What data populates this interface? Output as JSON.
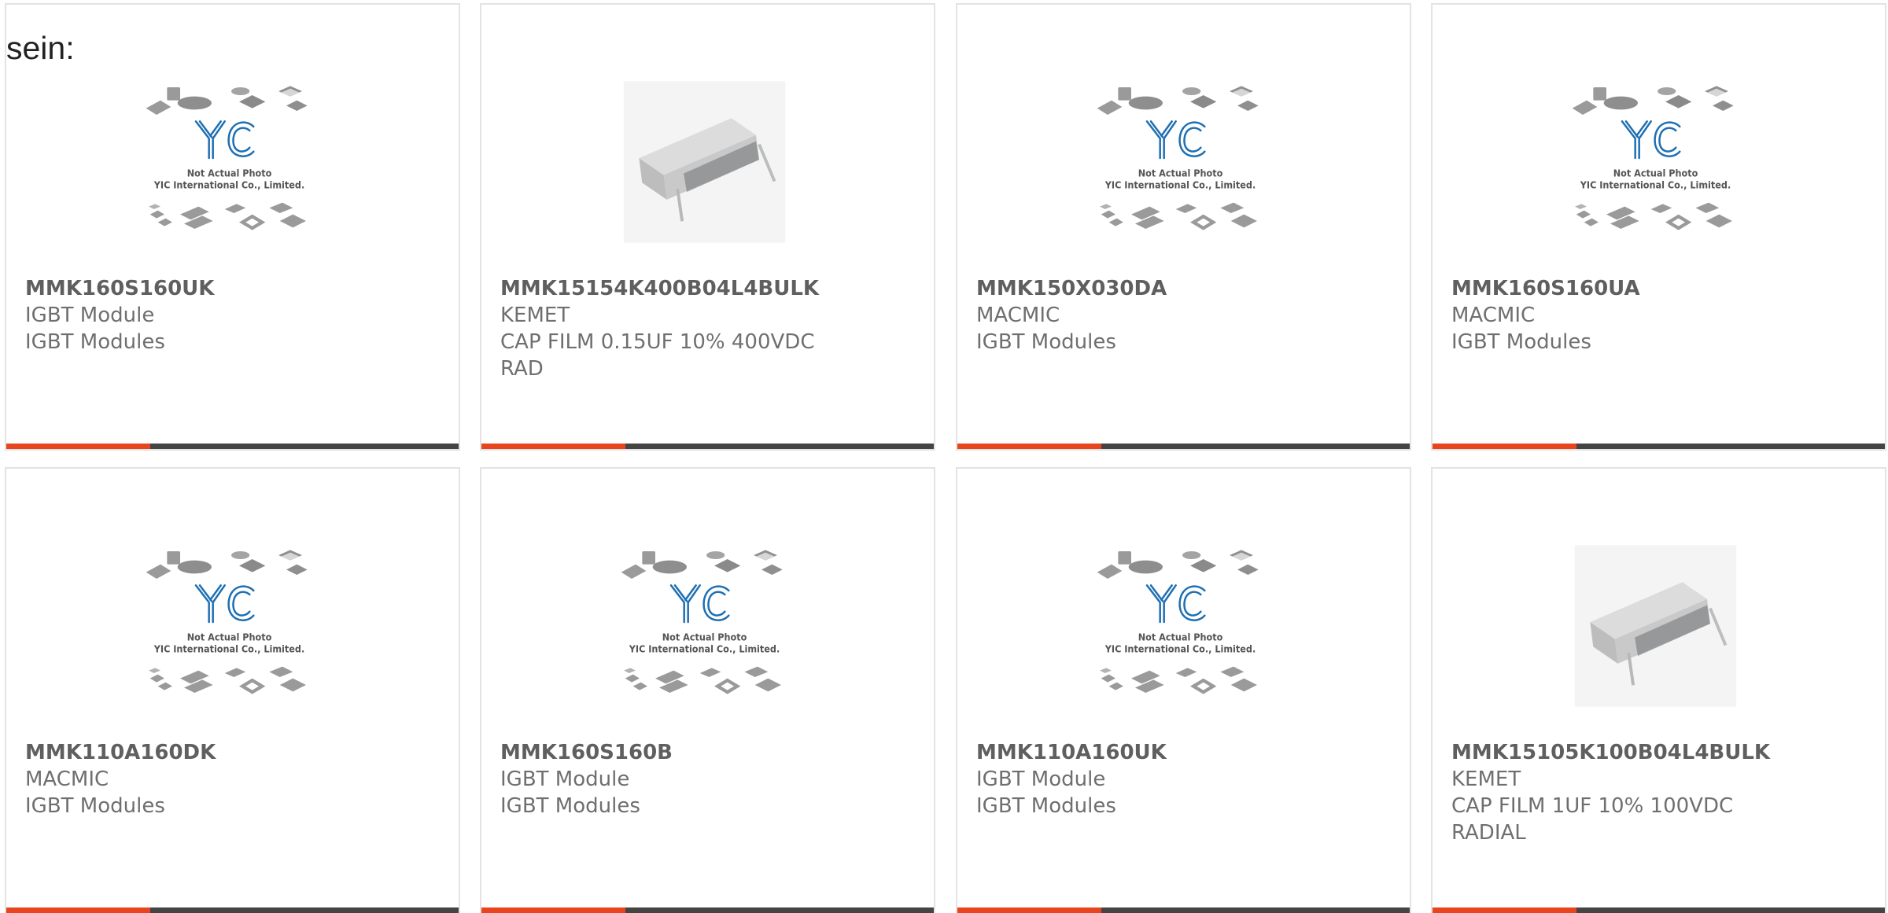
{
  "intro_text": "sein:",
  "colors": {
    "bar_accent": "#e8451f",
    "bar_dark": "#444444",
    "card_border": "#e3e3e3",
    "logo_blue": "#1e6fb3"
  },
  "placeholder_image": {
    "caption_line1": "Not Actual Photo",
    "caption_line2": "YIC International Co., Limited."
  },
  "cards": [
    {
      "part_number": "MMK160S160UK",
      "line2": "IGBT Module",
      "line3": "IGBT Modules",
      "line4": "",
      "image": "placeholder"
    },
    {
      "part_number": "MMK15154K400B04L4BULK",
      "line2": "KEMET",
      "line3": "CAP FILM 0.15UF 10% 400VDC",
      "line4": "RAD",
      "image": "capacitor-photo"
    },
    {
      "part_number": "MMK150X030DA",
      "line2": "MACMIC",
      "line3": "IGBT Modules",
      "line4": "",
      "image": "placeholder"
    },
    {
      "part_number": "MMK160S160UA",
      "line2": "MACMIC",
      "line3": "IGBT Modules",
      "line4": "",
      "image": "placeholder"
    },
    {
      "part_number": "MMK110A160DK",
      "line2": "MACMIC",
      "line3": "IGBT Modules",
      "line4": "",
      "image": "placeholder"
    },
    {
      "part_number": "MMK160S160B",
      "line2": "IGBT Module",
      "line3": "IGBT Modules",
      "line4": "",
      "image": "placeholder"
    },
    {
      "part_number": "MMK110A160UK",
      "line2": "IGBT Module",
      "line3": "IGBT Modules",
      "line4": "",
      "image": "placeholder"
    },
    {
      "part_number": "MMK15105K100B04L4BULK",
      "line2": "KEMET",
      "line3": "CAP FILM 1UF 10% 100VDC",
      "line4": "RADIAL",
      "image": "capacitor-photo"
    }
  ]
}
